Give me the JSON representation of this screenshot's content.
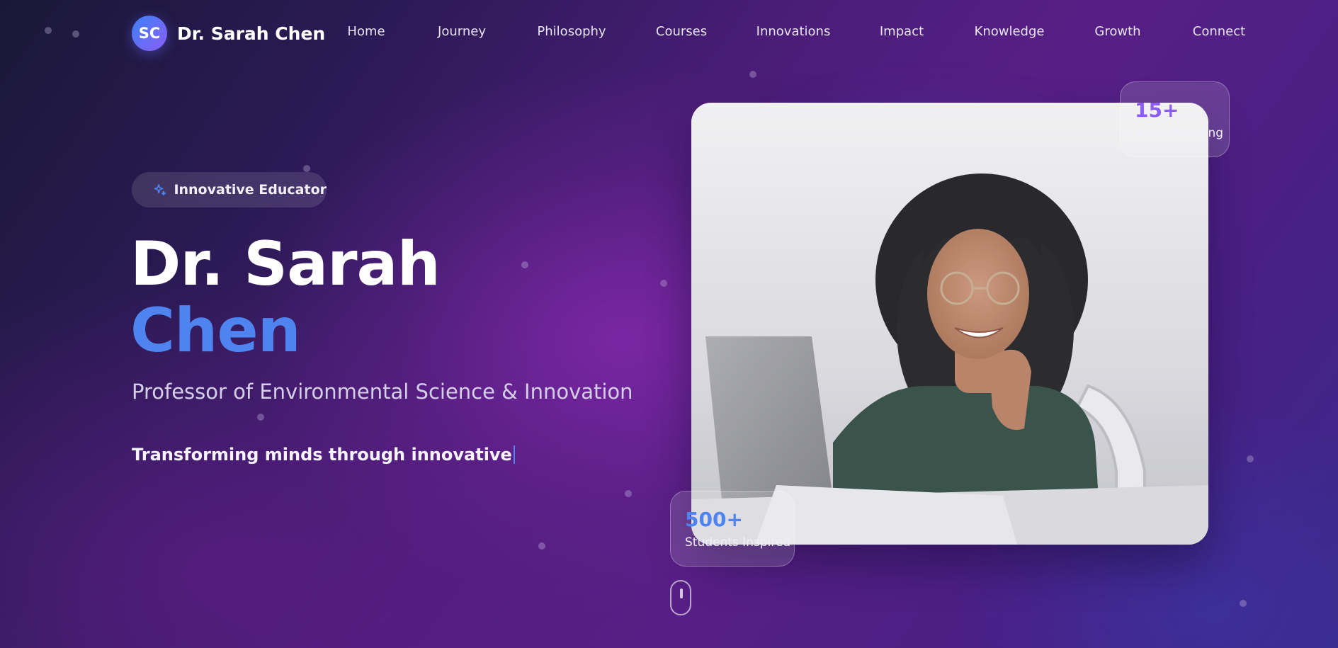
{
  "brand": {
    "initials": "SC",
    "name": "Dr. Sarah Chen"
  },
  "nav": {
    "links": [
      "Home",
      "Journey",
      "Philosophy",
      "Courses",
      "Innovations",
      "Impact",
      "Knowledge",
      "Growth",
      "Connect"
    ]
  },
  "hero": {
    "badge": {
      "icon": "sparkles-icon",
      "label": "Innovative Educator"
    },
    "name_first": "Dr. Sarah",
    "name_last": "Chen",
    "subtitle": "Professor of Environmental Science & Innovation",
    "typed_text": "Transforming minds through innovative"
  },
  "stats": {
    "years": {
      "value": "15+",
      "label": "Years Teaching"
    },
    "students": {
      "value": "500+",
      "label": "Students Inspired"
    }
  },
  "colors": {
    "accent_blue": "#4f83f0",
    "accent_purple": "#8b5cf6",
    "background_dark": "#1a1838",
    "background_purple": "#571f86"
  }
}
